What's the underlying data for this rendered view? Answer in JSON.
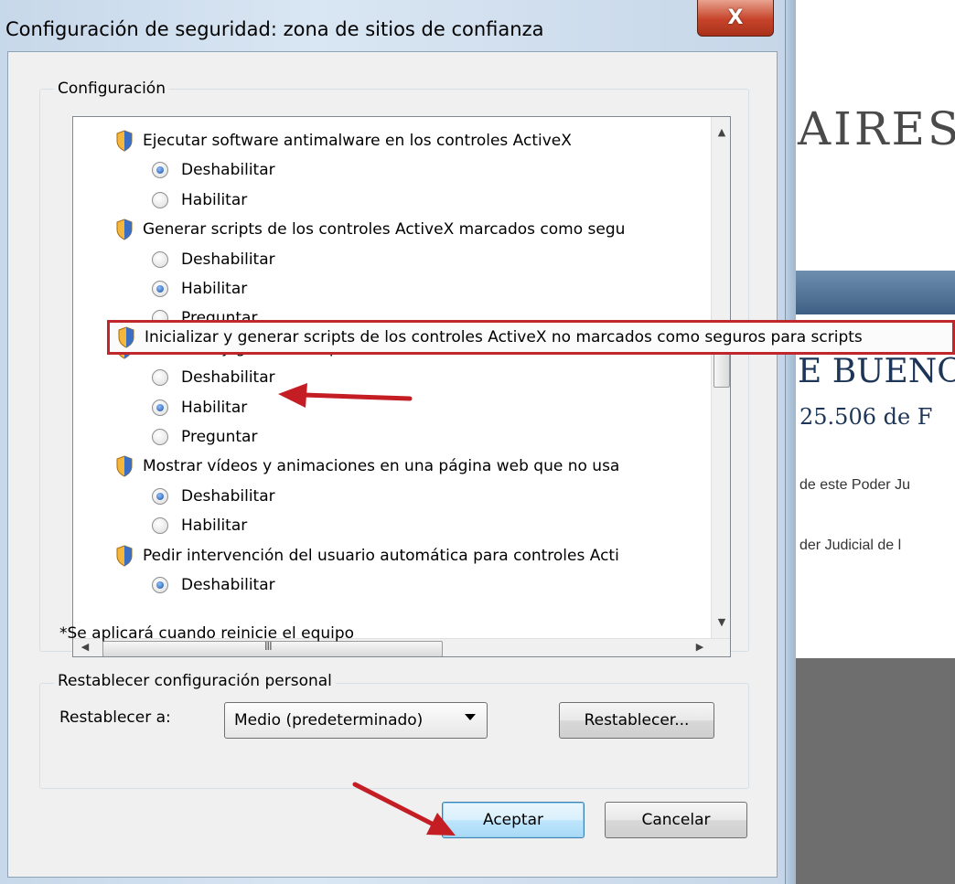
{
  "dialog": {
    "title": "Configuración de seguridad: zona de sitios de confianza",
    "close_symbol": "X"
  },
  "settings_group": {
    "legend": "Configuración",
    "items": [
      {
        "type": "setting",
        "label": "Ejecutar software antimalware en los controles ActiveX"
      },
      {
        "type": "option",
        "label": "Deshabilitar",
        "checked": true
      },
      {
        "type": "option",
        "label": "Habilitar",
        "checked": false
      },
      {
        "type": "setting",
        "label": "Generar scripts de los controles ActiveX marcados como segu"
      },
      {
        "type": "option",
        "label": "Deshabilitar",
        "checked": false
      },
      {
        "type": "option",
        "label": "Habilitar",
        "checked": true
      },
      {
        "type": "option",
        "label": "Preguntar",
        "checked": false
      },
      {
        "type": "setting",
        "label": "Inicializar y generar scripts de los controles ActiveX no marcados como seguros para scripts"
      },
      {
        "type": "option",
        "label": "Deshabilitar",
        "checked": false
      },
      {
        "type": "option",
        "label": "Habilitar",
        "checked": true
      },
      {
        "type": "option",
        "label": "Preguntar",
        "checked": false
      },
      {
        "type": "setting",
        "label": "Mostrar vídeos y animaciones en una página web que no usa"
      },
      {
        "type": "option",
        "label": "Deshabilitar",
        "checked": true
      },
      {
        "type": "option",
        "label": "Habilitar",
        "checked": false
      },
      {
        "type": "setting",
        "label": "Pedir intervención del usuario automática para controles Acti"
      },
      {
        "type": "option",
        "label": "Deshabilitar",
        "checked": true
      }
    ],
    "tooltip": "Inicializar y generar scripts de los controles ActiveX no marcados como seguros para scripts",
    "hscroll_grip": "III",
    "restart_note": "*Se aplicará cuando reinicie el equipo"
  },
  "reset_group": {
    "legend": "Restablecer configuración personal",
    "reset_to_label": "Restablecer a:",
    "level_selected": "Medio (predeterminado)",
    "reset_button": "Restablecer..."
  },
  "footer": {
    "accept_button": "Aceptar",
    "cancel_button": "Cancelar"
  },
  "webpage": {
    "brand": "AIRES",
    "title": "E BUENC",
    "subtitle": "25.506 de F",
    "line1": "de este Poder Ju",
    "line2": "der Judicial de l"
  },
  "colors": {
    "highlight": "#c0272d",
    "arrow": "#c41e24",
    "banner": "#4f6f93"
  }
}
